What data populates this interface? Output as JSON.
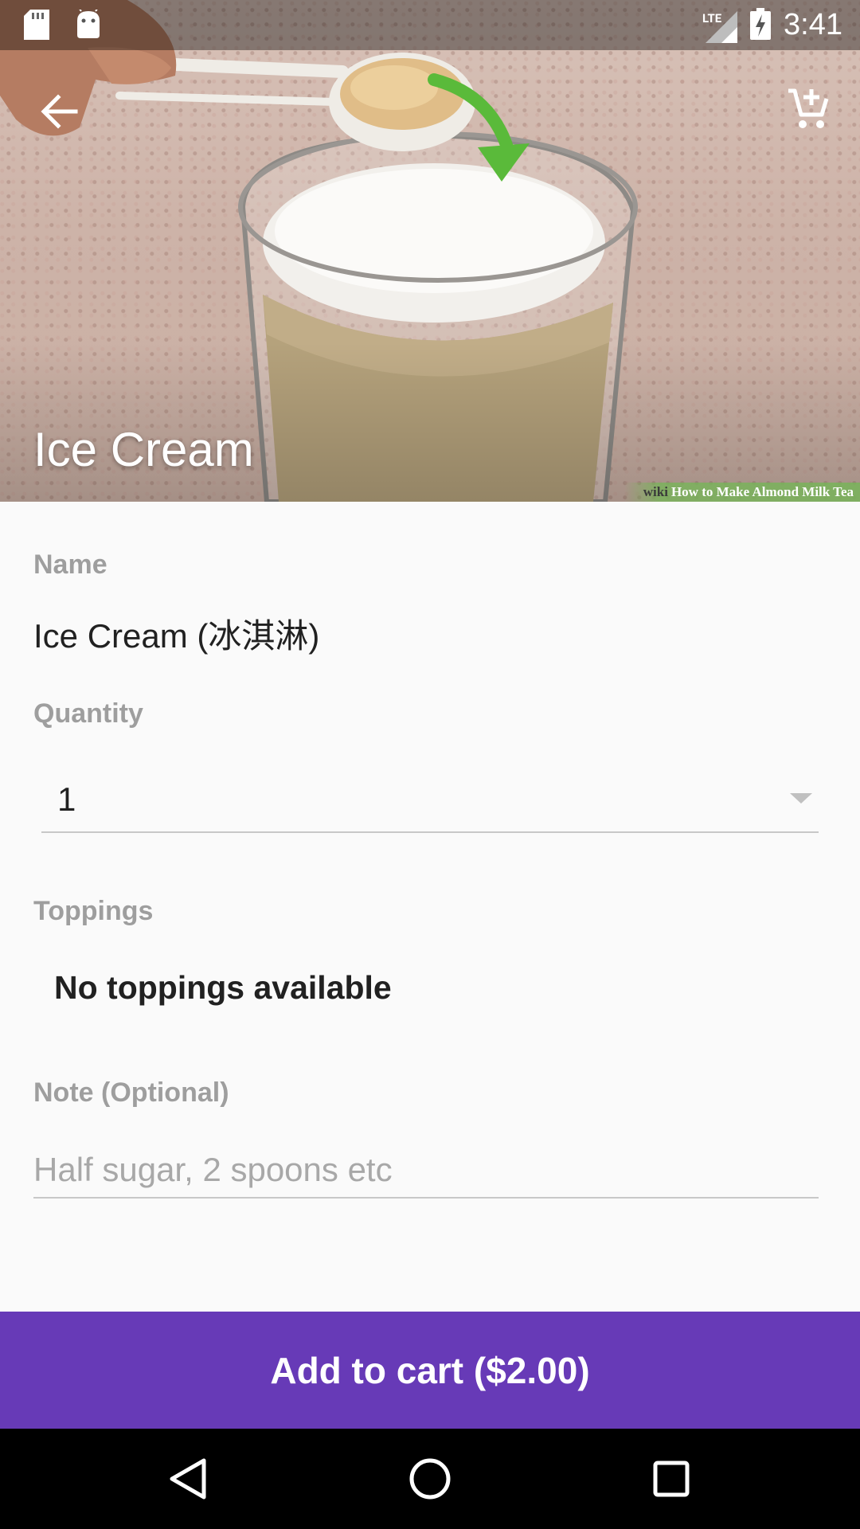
{
  "status_bar": {
    "network": "LTE",
    "time": "3:41",
    "icons": [
      "sd-card-icon",
      "android-icon",
      "lte-signal-icon",
      "battery-charging-icon"
    ]
  },
  "toolbar": {
    "back_icon": "arrow-back-icon",
    "cart_icon": "add-shopping-cart-icon"
  },
  "hero": {
    "title": "Ice Cream",
    "watermark_brand": "wiki",
    "watermark_text": "How to Make Almond Milk Tea"
  },
  "form": {
    "name_label": "Name",
    "name_value": "Ice Cream (冰淇淋)",
    "quantity_label": "Quantity",
    "quantity_value": "1",
    "toppings_label": "Toppings",
    "toppings_empty": "No toppings available",
    "note_label": "Note (Optional)",
    "note_placeholder": "Half sugar, 2 spoons etc",
    "note_value": ""
  },
  "action": {
    "add_to_cart_label": "Add to cart ($2.00)"
  },
  "colors": {
    "accent": "#673ab7",
    "label": "#9e9e9e",
    "text": "#212121"
  },
  "nav_bar": {
    "icons": [
      "back-triangle-icon",
      "home-circle-icon",
      "recents-square-icon"
    ]
  }
}
